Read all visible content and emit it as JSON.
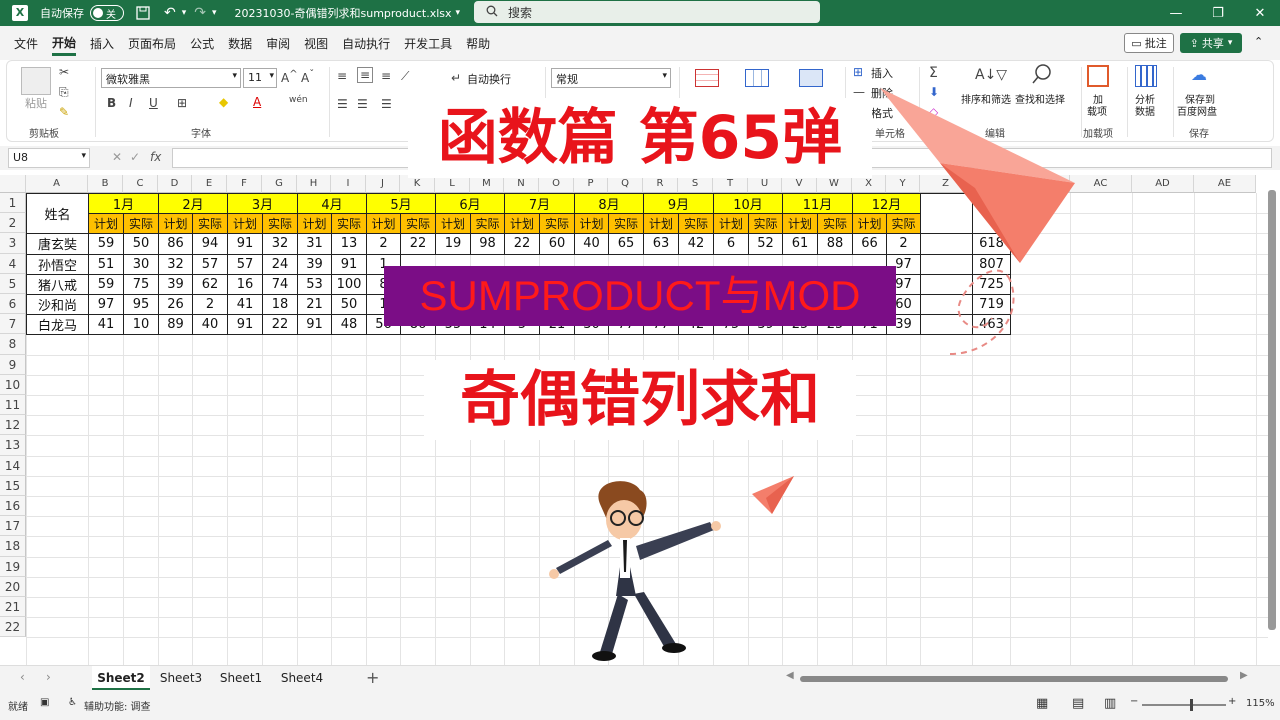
{
  "titlebar": {
    "autosave_label": "自动保存",
    "toggle_state": "关",
    "filename": "20231030-奇偶错列求和sumproduct.xlsx",
    "search_placeholder": "搜索",
    "minimize": "—",
    "restore": "❐",
    "close": "✕"
  },
  "menu": {
    "tabs": [
      "文件",
      "开始",
      "插入",
      "页面布局",
      "公式",
      "数据",
      "审阅",
      "视图",
      "自动执行",
      "开发工具",
      "帮助"
    ],
    "comment_label": "批注",
    "share_label": "共享"
  },
  "ribbon": {
    "paste_label": "粘贴",
    "clipboard_group": "剪贴板",
    "font_name": "微软雅黑",
    "font_size": "11",
    "font_group": "字体",
    "wrap_label": "自动换行",
    "number_format": "常规",
    "insert_label": "插入",
    "delete_label": "删除",
    "format_label": "格式",
    "cells_group": "单元格",
    "sort_filter_label": "排序和筛选",
    "find_select_label": "查找和选择",
    "edit_group": "编辑",
    "addin_label1": "加",
    "addin_label2": "载项",
    "addin_group": "加载项",
    "analyze_label1": "分析",
    "analyze_label2": "数据",
    "save_label1": "保存到",
    "save_label2": "百度网盘",
    "save_group": "保存",
    "bold": "B",
    "italic": "I",
    "underline": "U",
    "font_color": "A"
  },
  "formula": {
    "namebox": "U8",
    "fx": "fx"
  },
  "columns": [
    "A",
    "B",
    "C",
    "D",
    "E",
    "F",
    "G",
    "H",
    "I",
    "J",
    "K",
    "L",
    "M",
    "N",
    "O",
    "P",
    "Q",
    "R",
    "S",
    "T",
    "U",
    "V",
    "W",
    "X",
    "Y",
    "Z",
    "AA",
    "AB",
    "AC",
    "AD",
    "AE"
  ],
  "rows": [
    "1",
    "2",
    "3",
    "4",
    "5",
    "6",
    "7",
    "8",
    "9",
    "10",
    "11",
    "12",
    "13",
    "14",
    "15",
    "16",
    "17",
    "18",
    "19",
    "20",
    "21",
    "22"
  ],
  "table": {
    "name_header": "姓名",
    "months": [
      "1月",
      "2月",
      "3月",
      "4月",
      "5月",
      "6月",
      "7月",
      "8月",
      "9月",
      "10月",
      "11月",
      "12月"
    ],
    "plan": "计划",
    "actual": "实际",
    "names": [
      "唐玄奘",
      "孙悟空",
      "猪八戒",
      "沙和尚",
      "白龙马"
    ],
    "row3": [
      "59",
      "50",
      "86",
      "94",
      "91",
      "32",
      "31",
      "13",
      "2",
      "22",
      "19",
      "98",
      "22",
      "60",
      "40",
      "65",
      "63",
      "42",
      "6",
      "52",
      "61",
      "88",
      "66",
      "2"
    ],
    "row7": [
      "41",
      "10",
      "89",
      "40",
      "91",
      "22",
      "91",
      "48",
      "56",
      "86",
      "55",
      "14",
      "5",
      "21",
      "30",
      "77",
      "77",
      "42",
      "75",
      "39",
      "25",
      "25",
      "71",
      "39"
    ],
    "row4": [
      "51",
      "30",
      "32",
      "57",
      "57",
      "24",
      "39",
      "91",
      "1"
    ],
    "row5": [
      "59",
      "75",
      "39",
      "62",
      "16",
      "74",
      "53",
      "100",
      "8"
    ],
    "row6": [
      "97",
      "95",
      "26",
      "2",
      "41",
      "18",
      "21",
      "50",
      "1"
    ],
    "y_vals": [
      "97",
      "97",
      "60"
    ],
    "totals": [
      "618",
      "807",
      "725",
      "719",
      "463"
    ]
  },
  "overlays": {
    "title1": "函数篇 第65弹",
    "sumproduct": "SUMPRODUCT与MOD",
    "title2": "奇偶错列求和"
  },
  "sheets": [
    "Sheet2",
    "Sheet3",
    "Sheet1",
    "Sheet4"
  ],
  "status": {
    "ready": "就绪",
    "accessibility": "辅助功能: 调查",
    "zoom": "115%"
  },
  "colors": {
    "excel_green": "#1e7145",
    "month_yellow": "#ffff00",
    "sub_orange": "#ffc000",
    "overlay_red": "#e8141b",
    "overlay_purple": "#7b0d86",
    "plane_salmon": "#f47e6b"
  }
}
